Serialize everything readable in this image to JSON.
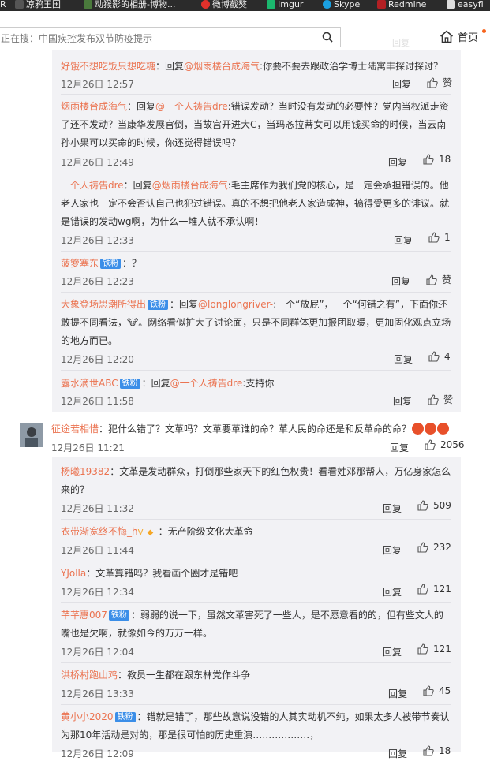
{
  "bookmarks": [
    {
      "label": "R",
      "color": "#2b2b2b",
      "icon": "r-tab"
    },
    {
      "label": "凉鸦王国",
      "color": "#444",
      "icon": "pixel-icon"
    },
    {
      "label": "动猴影的相册-博物...",
      "color": "#4a7a3c",
      "icon": "photo-icon"
    },
    {
      "label": "微博截獒",
      "color": "#e0312b",
      "icon": "weibo-icon"
    },
    {
      "label": "Imgur",
      "color": "#1bb76e",
      "icon": "imgur-icon"
    },
    {
      "label": "Skype",
      "color": "#1ba0e1",
      "icon": "skype-icon"
    },
    {
      "label": "Redmine",
      "color": "#b32024",
      "icon": "redmine-icon"
    },
    {
      "label": "easyfl",
      "color": "#ddd",
      "icon": "file-icon"
    }
  ],
  "search": {
    "value": "正在搜：中国疾控发布双节防疫提示"
  },
  "home": {
    "label": "首页"
  },
  "ghost_labels": {
    "a": "回复",
    "b": "赞"
  },
  "replies_a": [
    {
      "user": "好饿不想吃饭只想吃糖",
      "sep": "：回复",
      "at": "@烟雨楼台成海气",
      "text": ":你要不要去跟政治学博士陆寓丰探讨探讨？",
      "time": "12月26日 12:57",
      "reply": "回复",
      "likes": "赞"
    },
    {
      "user": "烟雨楼台成海气",
      "sep": "：回复",
      "at": "@一个人祷告dre",
      "text": ":错误发动？当时没有发动的必要性？党内当权派走资了还不发动？当康华发展官倒，当故宫开进大C，当玛忞拉蒂女可以用钱买命的时候，当云南孙小果可以买命的时候，你还觉得错误吗？",
      "time": "12月26日 12:49",
      "reply": "回复",
      "likes": "18"
    },
    {
      "user": "一个人祷告dre",
      "sep": "：回复",
      "at": "@烟雨楼台成海气",
      "text": ":毛主席作为我们党的核心，是一定会承担错误的。他老人家也一定不会否认自己也犯过错误。真的不想把他老人家造成神，搞得受更多的诽议。就是错误的发动wg啊，为什么一堆人就不承认啊！",
      "time": "12月26日 12:33",
      "reply": "回复",
      "likes": "1"
    },
    {
      "user": "菠箩塞东",
      "badge": "铁粉",
      "sep": "：？",
      "at": "",
      "text": "",
      "time": "12月26日 12:23",
      "reply": "回复",
      "likes": "赞"
    },
    {
      "user": "大象登场思潮所得出",
      "badge": "铁粉",
      "sep": "：回复",
      "at": "@longlongriver-",
      "text": ":一个“放屁”，一个“何错之有”，下面你还敢提不同看法，🐮。网络看似扩大了讨论面，只是不同群体更加报团取暖，更加固化观点立场的地方而已。",
      "time": "12月26日 12:20",
      "reply": "回复",
      "likes": "4"
    },
    {
      "user": "露水滴世ABC",
      "badge": "铁粉",
      "sep": "：回复",
      "at": "@一个人祷告dre",
      "text": ":支持你",
      "time": "12月26日 11:58",
      "reply": "回复",
      "likes": "赞"
    }
  ],
  "main_comment": {
    "user": "征途若相惜",
    "text": "：犯什么错了？文革吗？文革要革谁的命？革人民的命还是和反革命的命？",
    "time": "12月26日 11:21",
    "reply": "回复",
    "likes": "2056"
  },
  "replies_b": [
    {
      "user": "杨曦19382",
      "text": "：文革是发动群众，打倒那些家天下的红色权贵！看看姓邓那帮人，万亿身家怎么来的？",
      "time": "12月26日 11:32",
      "reply": "回复",
      "likes": "509"
    },
    {
      "user": "衣带渐宽终不悔_h",
      "text": "：无产阶级文化大革命",
      "time": "12月26日 11:44",
      "reply": "回复",
      "likes": "232"
    },
    {
      "user": "YJolla",
      "text": "：文革算错吗？我看画个圈才是错吧",
      "time": "12月26日 12:34",
      "reply": "回复",
      "likes": "121"
    },
    {
      "user": "芊芊惠007",
      "badge": "铁粉",
      "text": "：弱弱的说一下，虽然文革害死了一些人，是不愿意看的的，但有些文人的嘴也是欠啊，就像如今的万万一样。",
      "time": "12月26日 12:04",
      "reply": "回复",
      "likes": "121"
    },
    {
      "user": "洪桥村跑山鸡",
      "text": "：教员一生都在跟东林党作斗争",
      "time": "12月26日 13:33",
      "reply": "回复",
      "likes": "45"
    },
    {
      "user": "黄小小2020",
      "badge": "铁粉",
      "text": "：错就是错了，那些故意说没错的人其实动机不纯，如果太多人被带节奏认为那10年活动是对的，那是很可怕的历史重演………………，",
      "time": "12月26日 12:09",
      "reply": "回复",
      "likes": "18"
    }
  ]
}
